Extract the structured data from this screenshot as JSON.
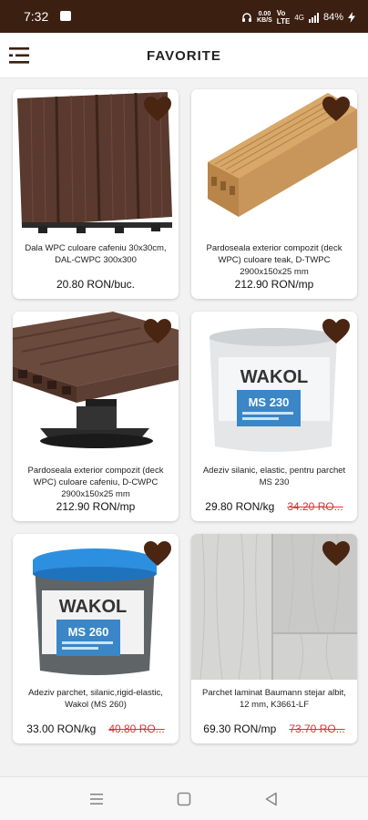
{
  "status_bar": {
    "time": "7:32",
    "net_speed": "0.00",
    "net_unit": "KB/S",
    "network_type": "4G",
    "battery": "84%"
  },
  "header": {
    "title": "FAVORITE"
  },
  "products": [
    {
      "name": "Dala WPC culoare cafeniu 30x30cm, DAL-CWPC 300x300",
      "price": "20.80 RON/buc.",
      "old_price": ""
    },
    {
      "name": "Pardoseala exterior compozit (deck WPC) culoare teak, D-TWPC 2900x150x25 mm",
      "price": "212.90 RON/mp",
      "old_price": ""
    },
    {
      "name": "Pardoseala exterior compozit (deck WPC) culoare cafeniu, D-CWPC 2900x150x25 mm",
      "price": "212.90 RON/mp",
      "old_price": ""
    },
    {
      "name": "Adeziv silanic, elastic, pentru parchet MS 230",
      "price": "29.80 RON/kg",
      "old_price": "34.20 RO...",
      "brand": "WAKOL",
      "product_code": "MS 230"
    },
    {
      "name": "Adeziv parchet, silanic,rigid-elastic, Wakol (MS 260)",
      "price": "33.00 RON/kg",
      "old_price": "40.80 RO...",
      "brand": "WAKOL",
      "product_code": "MS 260"
    },
    {
      "name": "Parchet laminat Baumann stejar albit, 12 mm, K3661-LF",
      "price": "69.30 RON/mp",
      "old_price": "73.70 RO..."
    }
  ],
  "colors": {
    "header_bg": "#3b1f10",
    "heart": "#4a2512",
    "old_price": "#d33333"
  },
  "icons": {
    "menu": "menu-icon",
    "favorite": "heart-icon",
    "nav_recents": "recents-icon",
    "nav_home": "home-icon",
    "nav_back": "back-icon"
  }
}
